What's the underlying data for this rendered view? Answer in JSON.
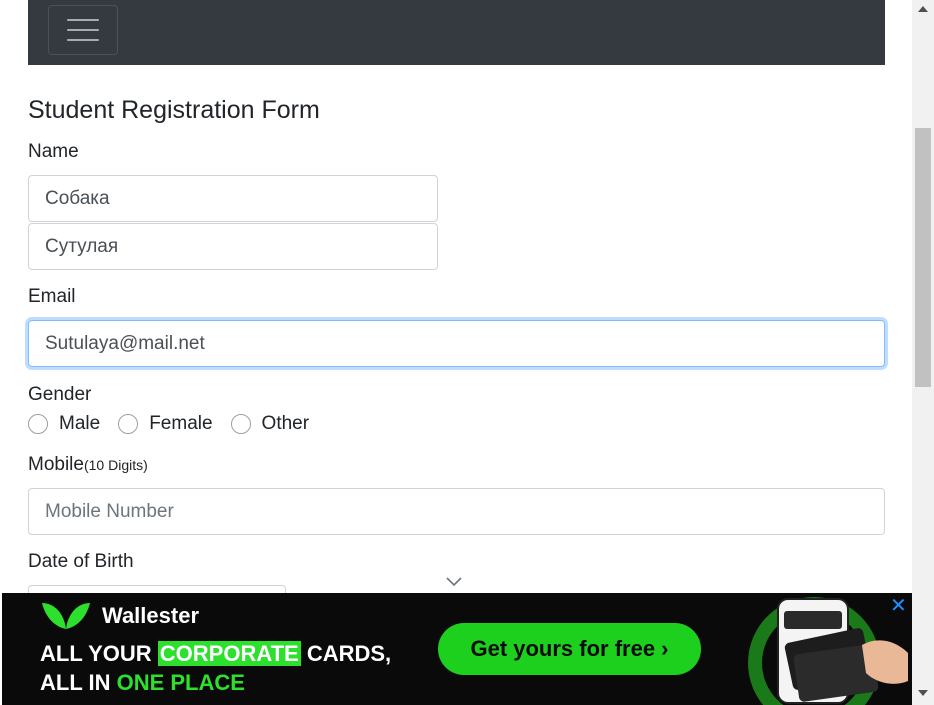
{
  "form": {
    "title": "Student Registration Form",
    "name_label": "Name",
    "first_name_value": "Собака",
    "last_name_value": "Сутулая",
    "email_label": "Email",
    "email_value": "Sutulaya@mail.net",
    "gender_label": "Gender",
    "gender_options": [
      "Male",
      "Female",
      "Other"
    ],
    "mobile_label": "Mobile",
    "mobile_hint": "(10 Digits)",
    "mobile_placeholder": "Mobile Number",
    "dob_label": "Date of Birth"
  },
  "ad": {
    "brand": "Wallester",
    "headline_line1_a": "ALL YOUR ",
    "headline_line1_highlight": "CORPORATE",
    "headline_line1_b": " CARDS,",
    "headline_line2_a": "ALL IN ",
    "headline_line2_green": "ONE PLACE",
    "cta": "Get yours for free ›",
    "close_glyph": "✕",
    "accent_color": "#2ee02e"
  },
  "icons": {
    "menu": "hamburger-menu-icon",
    "dropdown": "chevron-down-icon",
    "close": "close-icon",
    "logo": "wallester-logo-icon"
  }
}
